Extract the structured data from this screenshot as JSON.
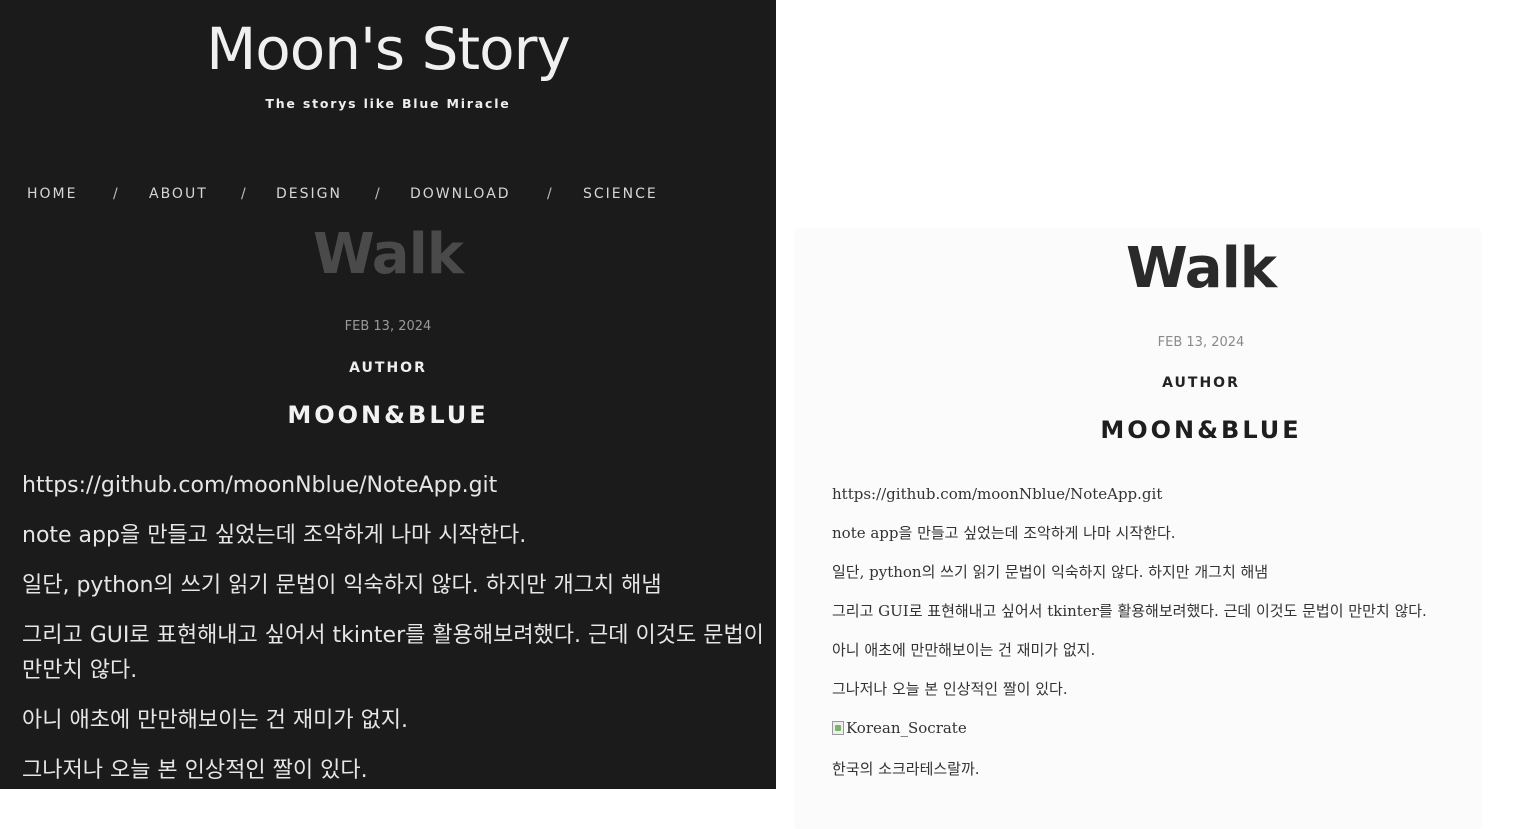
{
  "site": {
    "title": "Moon's Story",
    "subtitle": "The storys like Blue Miracle"
  },
  "nav": {
    "items": [
      "HOME",
      "ABOUT",
      "DESIGN",
      "DOWNLOAD",
      "SCIENCE"
    ],
    "separator": "/"
  },
  "post": {
    "title": "Walk",
    "date": "FEB 13, 2024",
    "author_label": "AUTHOR",
    "author_name": "MOON&BLUE"
  },
  "left_content": {
    "paragraphs": [
      "https://github.com/moonNblue/NoteApp.git",
      "note app을 만들고 싶었는데 조악하게 나마 시작한다.",
      "일단, python의 쓰기 읽기 문법이 익숙하지 않다. 하지만 개그치 해냄",
      "그리고 GUI로 표현해내고 싶어서 tkinter를 활용해보려했다. 근데 이것도 문법이 만만치 않다.",
      "아니 애초에 만만해보이는 건 재미가 없지.",
      "그나저나 오늘 본 인상적인 짤이 있다."
    ]
  },
  "right_content": {
    "paragraphs": [
      "https://github.com/moonNblue/NoteApp.git",
      "note app을 만들고 싶었는데 조악하게 나마 시작한다.",
      "일단, python의 쓰기 읽기 문법이 익숙하지 않다. 하지만 개그치 해냄",
      "그리고 GUI로 표현해내고 싶어서 tkinter를 활용해보려했다. 근데 이것도 문법이 만만치 않다.",
      "아니 애초에 만만해보이는 건 재미가 없지.",
      "그나저나 오늘 본 인상적인 짤이 있다."
    ],
    "image_alt": "Korean_Socrate",
    "caption": "한국의 소크라테스랄까."
  },
  "colors": {
    "dark_bg": "#1b1b1b",
    "light_card_bg": "#fbfbfb"
  }
}
